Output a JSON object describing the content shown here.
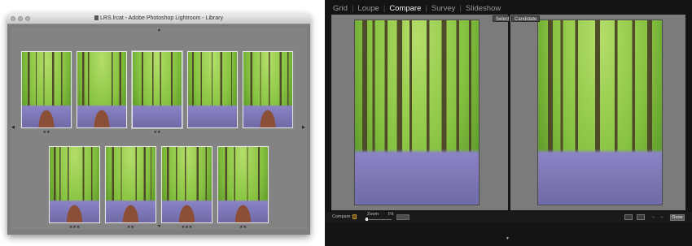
{
  "survey_window": {
    "title": "LRS.lrcat - Adobe Photoshop Lightroom - Library",
    "top_row": [
      {
        "stars": "★★",
        "variant": "lane-a",
        "selected": false
      },
      {
        "stars": "",
        "variant": "path-a",
        "selected": false
      },
      {
        "stars": "★★",
        "variant": "bluebell-a",
        "selected": true
      },
      {
        "stars": "",
        "variant": "light-a",
        "selected": false
      },
      {
        "stars": "",
        "variant": "lane-b",
        "selected": false
      }
    ],
    "bottom_row": [
      {
        "stars": "★★★",
        "variant": "path-b",
        "selected": false
      },
      {
        "stars": "★★",
        "variant": "path-c",
        "selected": false
      },
      {
        "stars": "★★★",
        "variant": "path-d",
        "selected": false
      },
      {
        "stars": "★★",
        "variant": "path-e",
        "selected": false
      }
    ]
  },
  "compare_window": {
    "modules": [
      {
        "label": "Grid",
        "active": false
      },
      {
        "label": "Loupe",
        "active": false
      },
      {
        "label": "Compare",
        "active": true
      },
      {
        "label": "Survey",
        "active": false
      },
      {
        "label": "Slideshow",
        "active": false
      }
    ],
    "select_label": "Select",
    "candidate_label": "Candidate",
    "toolbar": {
      "compare_label": "Compare :",
      "zoom_label": "Zoom",
      "fit_label": "Fit",
      "done_label": "Done"
    }
  },
  "colors": {
    "foliage": "#86c240",
    "foliage_light": "#b4de6a",
    "trunk": "#4f4a28",
    "bluebell": "#8b84c4",
    "path": "#8a4f36"
  }
}
